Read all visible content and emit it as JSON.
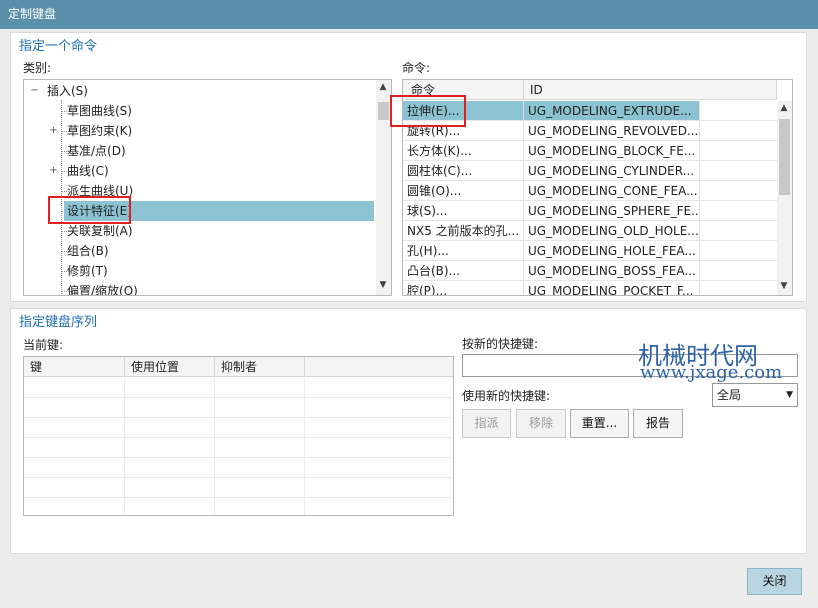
{
  "window": {
    "title": "定制键盘"
  },
  "specify_command": {
    "title": "指定一个命令",
    "category_label": "类别:",
    "command_label": "命令:",
    "tree": [
      {
        "label": "插入(S)",
        "expander": "−"
      },
      {
        "label": "草图曲线(S)",
        "expander": ""
      },
      {
        "label": "草图约束(K)",
        "expander": "+"
      },
      {
        "label": "基准/点(D)",
        "expander": ""
      },
      {
        "label": "曲线(C)",
        "expander": "+"
      },
      {
        "label": "派生曲线(U)",
        "expander": ""
      },
      {
        "label": "设计特征(E)",
        "expander": "",
        "selected": true
      },
      {
        "label": "关联复制(A)",
        "expander": ""
      },
      {
        "label": "组合(B)",
        "expander": ""
      },
      {
        "label": "修剪(T)",
        "expander": ""
      },
      {
        "label": "偏置/缩放(O)",
        "expander": ""
      }
    ],
    "command_columns": [
      "命令",
      "ID"
    ],
    "commands": [
      {
        "name": "拉伸(E)...",
        "id": "UG_MODELING_EXTRUDE...",
        "selected": true
      },
      {
        "name": "旋转(R)...",
        "id": "UG_MODELING_REVOLVED..."
      },
      {
        "name": "长方体(K)...",
        "id": "UG_MODELING_BLOCK_FE..."
      },
      {
        "name": "圆柱体(C)...",
        "id": "UG_MODELING_CYLINDER..."
      },
      {
        "name": "圆锥(O)...",
        "id": "UG_MODELING_CONE_FEA..."
      },
      {
        "name": "球(S)...",
        "id": "UG_MODELING_SPHERE_FE..."
      },
      {
        "name": "NX5 之前版本的孔...",
        "id": "UG_MODELING_OLD_HOLE..."
      },
      {
        "name": "孔(H)...",
        "id": "UG_MODELING_HOLE_FEA..."
      },
      {
        "name": "凸台(B)...",
        "id": "UG_MODELING_BOSS_FEA..."
      },
      {
        "name": "腔(P)...",
        "id": "UG_MODELING_POCKET_F..."
      }
    ]
  },
  "key_sequence": {
    "title": "指定键盘序列",
    "current_keys_label": "当前键:",
    "columns": [
      "键",
      "使用位置",
      "抑制者"
    ],
    "new_shortcut_label": "按新的快捷键:",
    "new_shortcut_value": "",
    "use_new_label": "使用新的快捷键:",
    "scope_value": "全局",
    "buttons": {
      "assign": "指派",
      "remove": "移除",
      "reset": "重置...",
      "report": "报告"
    }
  },
  "footer": {
    "close": "关闭"
  },
  "watermark": {
    "line1": "机械时代网",
    "line2": "www.jxage.com"
  },
  "colors": {
    "accent": "#5b90aa",
    "selection": "#8cc3d3",
    "highlight_box": "#e02020",
    "section_title": "#1f6fb4"
  }
}
